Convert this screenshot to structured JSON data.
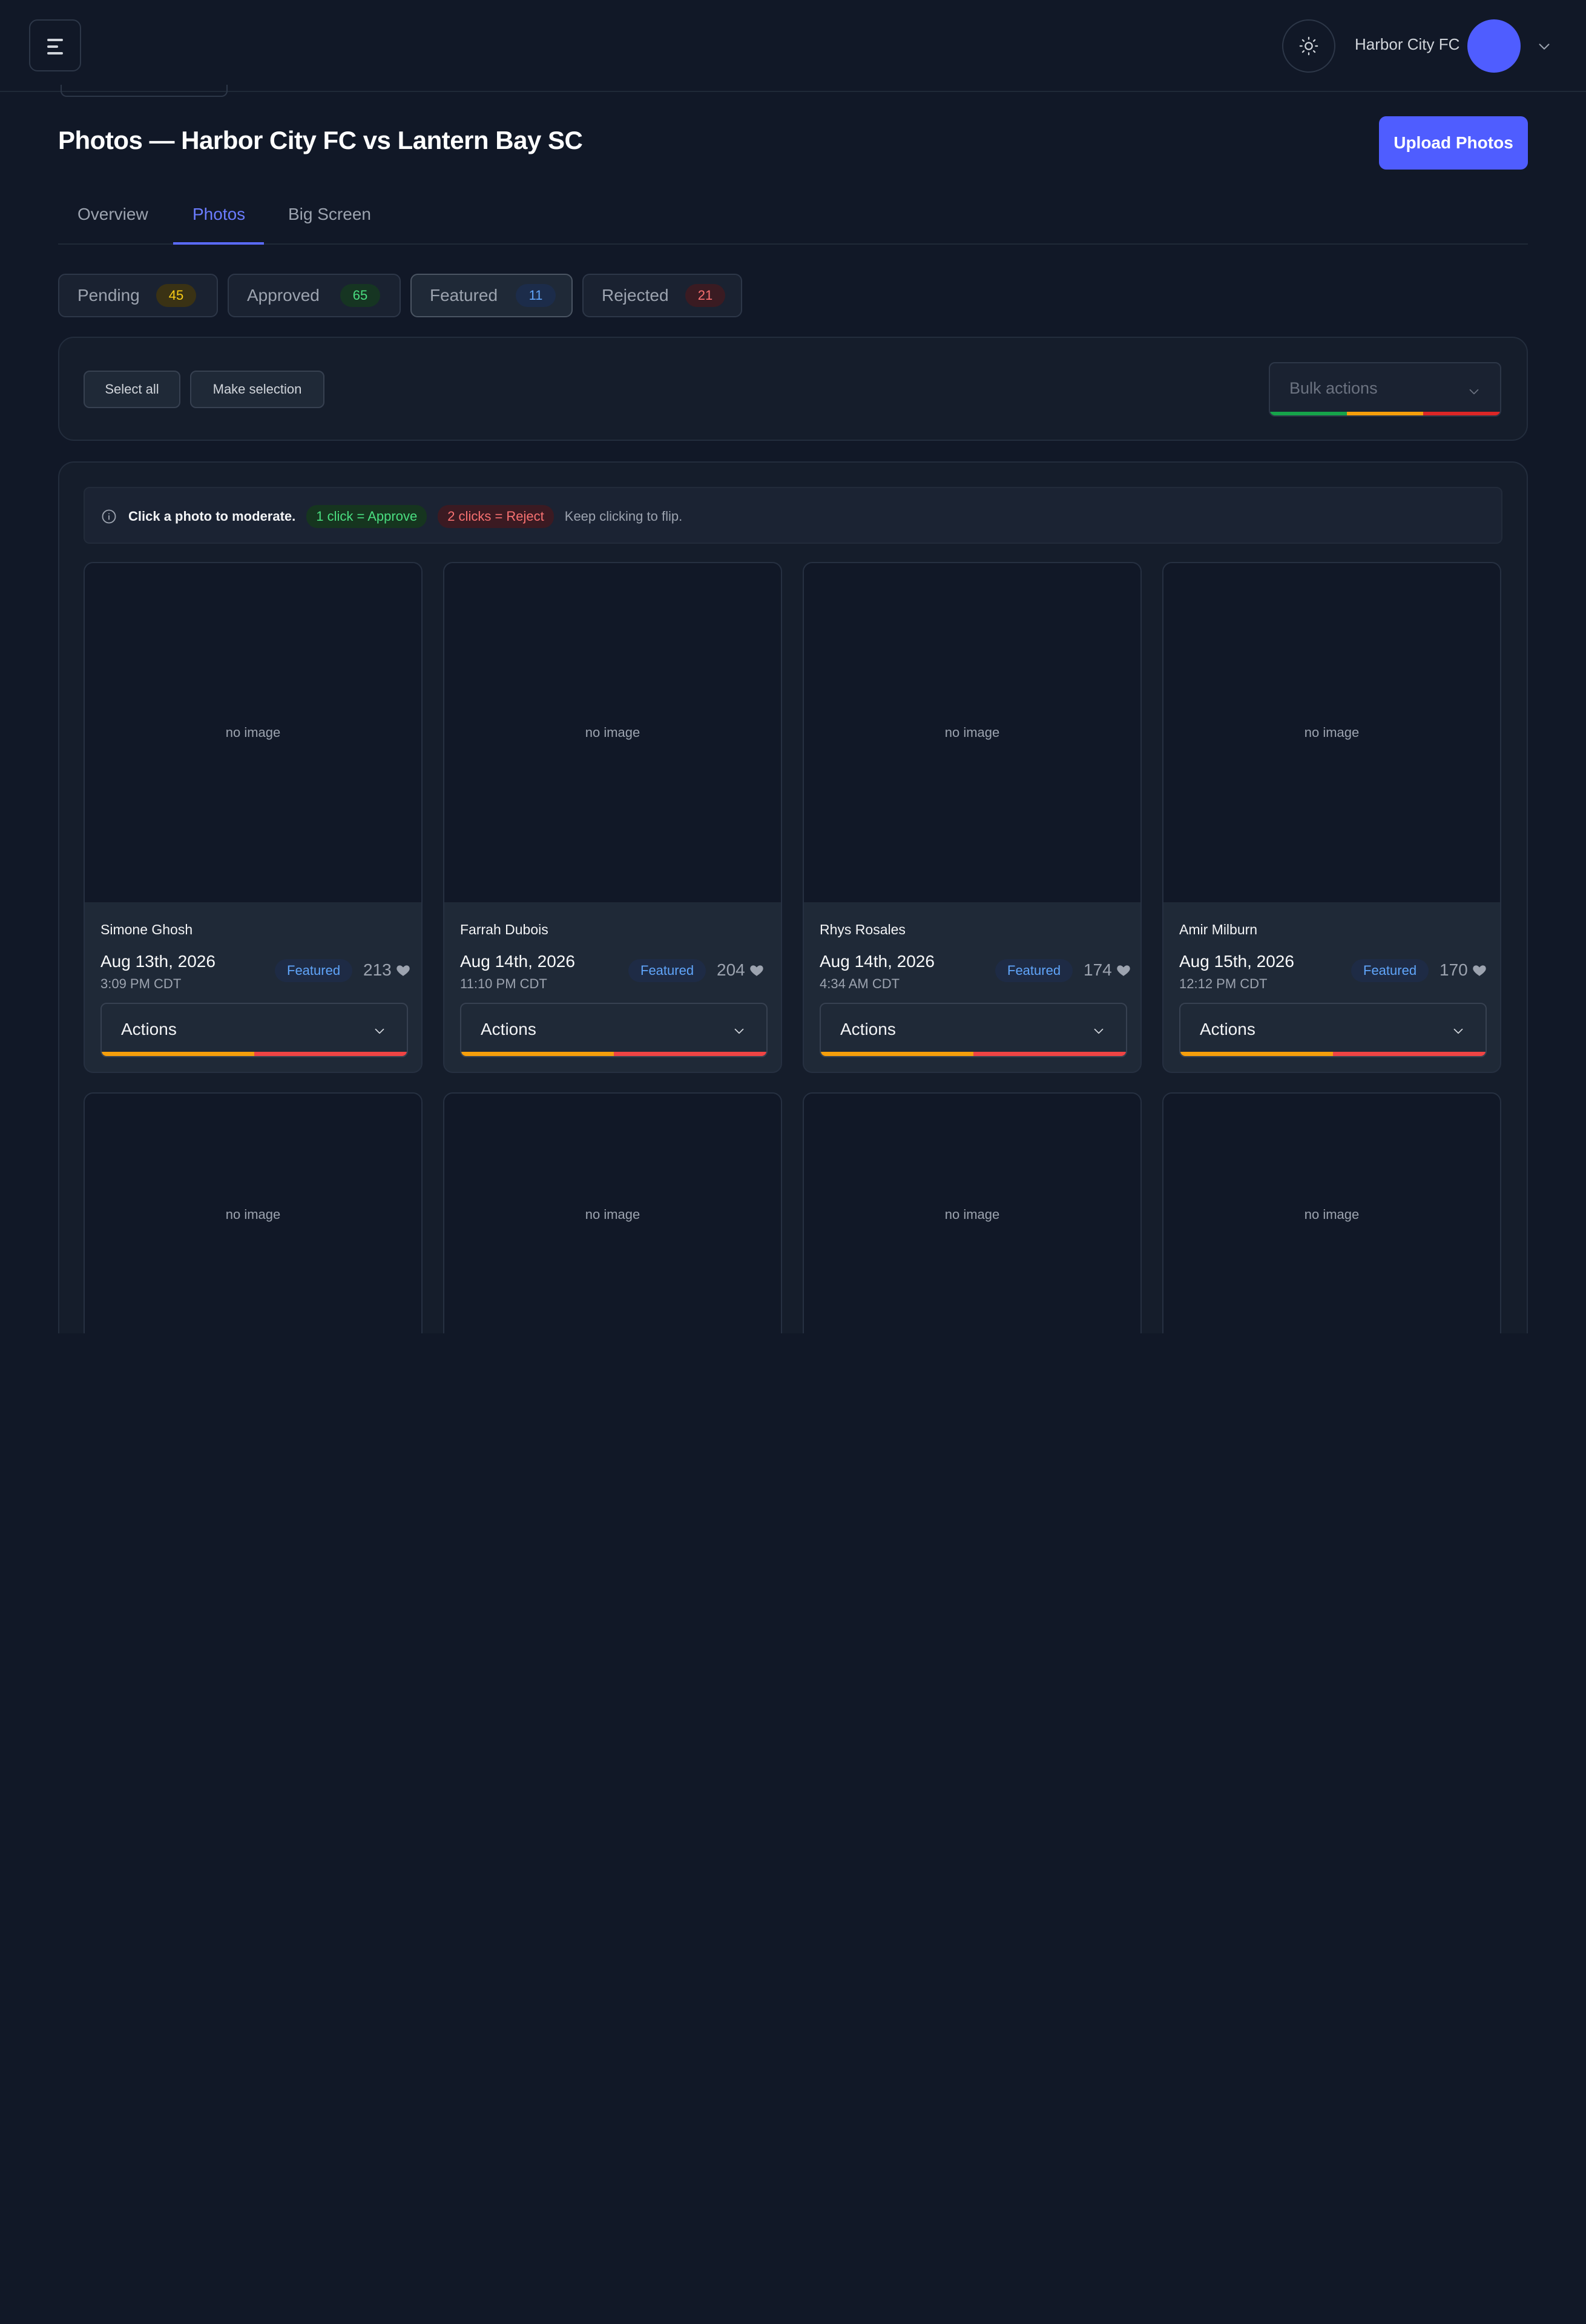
{
  "header": {
    "org_name": "Harbor City FC",
    "menu_icon": "hamburger-menu-icon",
    "theme_icon": "sun-icon",
    "account_chevron_icon": "chevron-down-icon"
  },
  "page": {
    "title": "Photos — Harbor City FC vs Lantern Bay SC",
    "upload_label": "Upload Photos"
  },
  "tabs": [
    {
      "label": "Overview",
      "active": false
    },
    {
      "label": "Photos",
      "active": true
    },
    {
      "label": "Big Screen",
      "active": false
    }
  ],
  "filters": [
    {
      "label": "Pending",
      "count": "45",
      "count_color": "#facc15",
      "count_bg": "#3a3214"
    },
    {
      "label": "Approved",
      "count": "65",
      "count_color": "#4ade80",
      "count_bg": "#163522"
    },
    {
      "label": "Featured",
      "count": "11",
      "count_color": "#60a5fa",
      "count_bg": "#1c2c4a",
      "active": true
    },
    {
      "label": "Rejected",
      "count": "21",
      "count_color": "#f87171",
      "count_bg": "#3a1b22"
    }
  ],
  "bulk": {
    "select_all_label": "Select all",
    "make_selection_label": "Make selection",
    "bulk_actions_label": "Bulk actions",
    "bar_colors": [
      "#16a34a",
      "#f59e0b",
      "#dc2626"
    ]
  },
  "hint": {
    "info_icon": "info-icon",
    "strong": "Click a photo to moderate.",
    "approve": "1 click = Approve",
    "reject": "2 clicks = Reject",
    "muted": "Keep clicking to flip."
  },
  "photos": [
    {
      "placeholder": "no image",
      "name": "Simone Ghosh",
      "date": "Aug 13th, 2026",
      "time": "3:09 PM CDT",
      "badge": "Featured",
      "likes": "213",
      "actions_label": "Actions"
    },
    {
      "placeholder": "no image",
      "name": "Farrah Dubois",
      "date": "Aug 14th, 2026",
      "time": "11:10 PM CDT",
      "badge": "Featured",
      "likes": "204",
      "actions_label": "Actions"
    },
    {
      "placeholder": "no image",
      "name": "Rhys Rosales",
      "date": "Aug 14th, 2026",
      "time": "4:34 AM CDT",
      "badge": "Featured",
      "likes": "174",
      "actions_label": "Actions"
    },
    {
      "placeholder": "no image",
      "name": "Amir Milburn",
      "date": "Aug 15th, 2026",
      "time": "12:12 PM CDT",
      "badge": "Featured",
      "likes": "170",
      "actions_label": "Actions"
    }
  ],
  "photos_row2": [
    {
      "placeholder": "no image"
    },
    {
      "placeholder": "no image"
    },
    {
      "placeholder": "no image"
    },
    {
      "placeholder": "no image"
    }
  ],
  "action_bar_colors": [
    "#f59e0b",
    "#ef4444"
  ],
  "heart_icon": "heart-icon"
}
